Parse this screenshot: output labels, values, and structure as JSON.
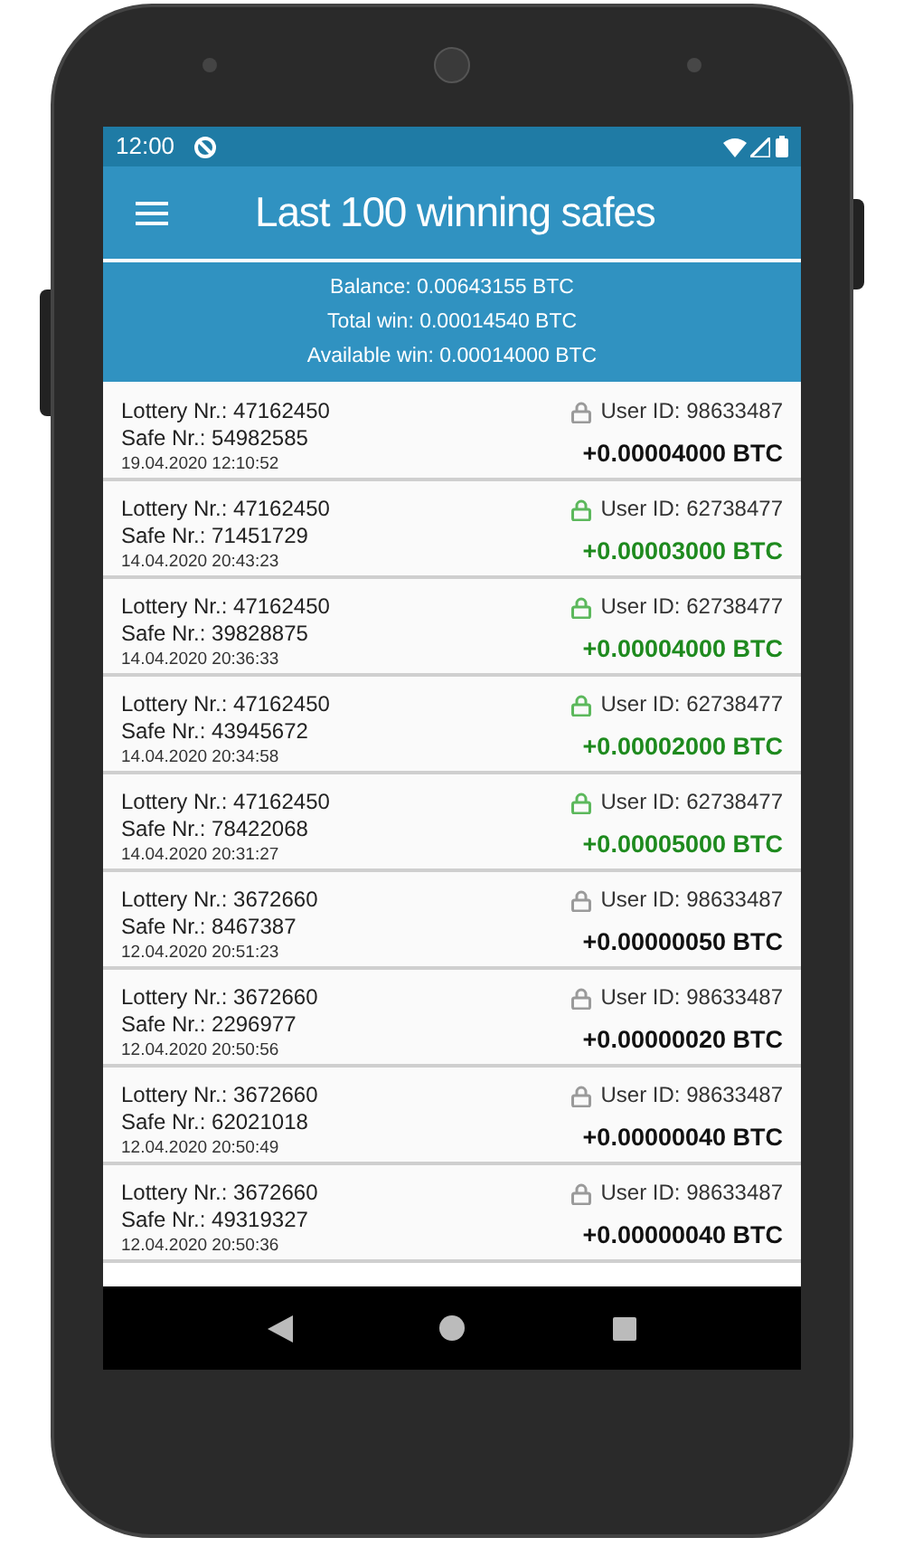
{
  "status_bar": {
    "time": "12:00"
  },
  "app_bar": {
    "title": "Last 100 winning safes"
  },
  "summary": [
    "Balance: 0.00643155 BTC",
    "Total win: 0.00014540 BTC",
    "Available win: 0.00014000 BTC"
  ],
  "wins": [
    {
      "lottery": "Lottery Nr.: 47162450",
      "safe": "Safe Nr.: 54982585",
      "date": "19.04.2020 12:10:52",
      "user": "User ID: 98633487",
      "amount": "+0.00004000 BTC",
      "own": false
    },
    {
      "lottery": "Lottery Nr.: 47162450",
      "safe": "Safe Nr.: 71451729",
      "date": "14.04.2020 20:43:23",
      "user": "User ID: 62738477",
      "amount": "+0.00003000 BTC",
      "own": true
    },
    {
      "lottery": "Lottery Nr.: 47162450",
      "safe": "Safe Nr.: 39828875",
      "date": "14.04.2020 20:36:33",
      "user": "User ID: 62738477",
      "amount": "+0.00004000 BTC",
      "own": true
    },
    {
      "lottery": "Lottery Nr.: 47162450",
      "safe": "Safe Nr.: 43945672",
      "date": "14.04.2020 20:34:58",
      "user": "User ID: 62738477",
      "amount": "+0.00002000 BTC",
      "own": true
    },
    {
      "lottery": "Lottery Nr.: 47162450",
      "safe": "Safe Nr.: 78422068",
      "date": "14.04.2020 20:31:27",
      "user": "User ID: 62738477",
      "amount": "+0.00005000 BTC",
      "own": true
    },
    {
      "lottery": "Lottery Nr.: 3672660",
      "safe": "Safe Nr.: 8467387",
      "date": "12.04.2020 20:51:23",
      "user": "User ID: 98633487",
      "amount": "+0.00000050 BTC",
      "own": false
    },
    {
      "lottery": "Lottery Nr.: 3672660",
      "safe": "Safe Nr.: 2296977",
      "date": "12.04.2020 20:50:56",
      "user": "User ID: 98633487",
      "amount": "+0.00000020 BTC",
      "own": false
    },
    {
      "lottery": "Lottery Nr.: 3672660",
      "safe": "Safe Nr.: 62021018",
      "date": "12.04.2020 20:50:49",
      "user": "User ID: 98633487",
      "amount": "+0.00000040 BTC",
      "own": false
    },
    {
      "lottery": "Lottery Nr.: 3672660",
      "safe": "Safe Nr.: 49319327",
      "date": "12.04.2020 20:50:36",
      "user": "User ID: 98633487",
      "amount": "+0.00000040 BTC",
      "own": false
    }
  ]
}
